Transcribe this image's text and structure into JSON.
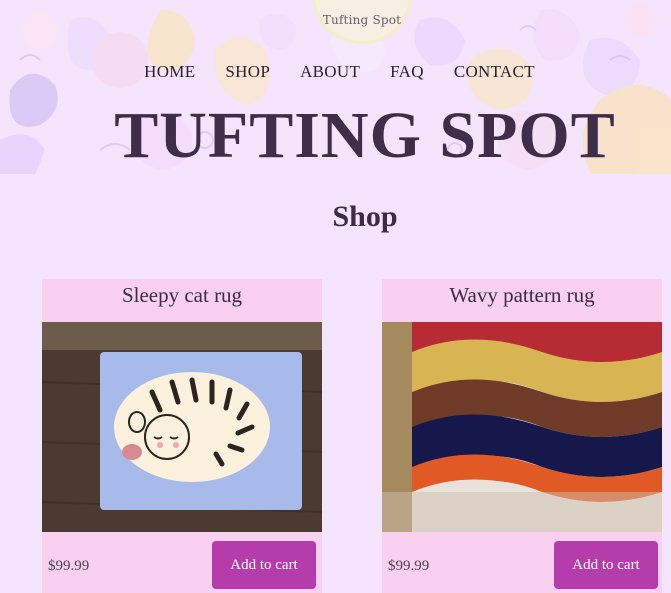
{
  "brand": {
    "logo_text": "Tufting Spot",
    "site_title": "TUFTING SPOT"
  },
  "nav": {
    "items": [
      "HOME",
      "SHOP",
      "ABOUT",
      "FAQ",
      "CONTACT"
    ]
  },
  "shop": {
    "heading": "Shop",
    "products": [
      {
        "name": "Sleepy cat rug",
        "price": "$99.99",
        "button": "Add to cart",
        "image": "sleeping tabby cat rug on blue"
      },
      {
        "name": "Wavy pattern rug",
        "price": "$99.99",
        "button": "Add to cart",
        "image": "multicolor wavy stripes rug"
      }
    ]
  },
  "colors": {
    "page_bg": "#f4e4fd",
    "card_bg": "#f9d0ef",
    "button": "#b53cab",
    "title_text": "#3f2d4a"
  }
}
